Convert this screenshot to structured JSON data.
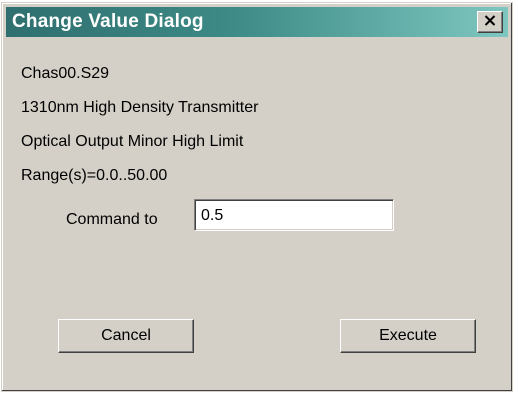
{
  "window": {
    "title": "Change Value Dialog",
    "close_icon": "close-icon"
  },
  "info": {
    "lines": [
      "Chas00.S29",
      "1310nm High Density Transmitter",
      "Optical Output Minor High Limit",
      "Range(s)=0.0..50.00"
    ]
  },
  "command": {
    "label": "Command to",
    "value": "0.5"
  },
  "buttons": {
    "cancel_label": "Cancel",
    "execute_label": "Execute"
  },
  "colors": {
    "titlebar_start": "#2f6f6f",
    "titlebar_end": "#7ec7c0",
    "dialog_face": "#d4d0c8"
  }
}
